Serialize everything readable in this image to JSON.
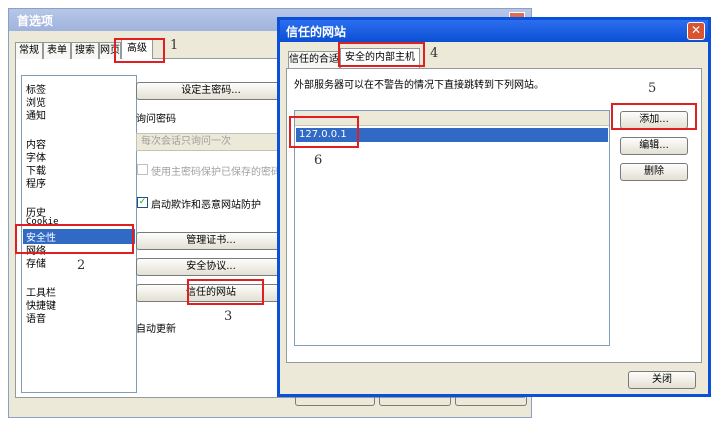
{
  "prefs": {
    "title": "首选项",
    "tabs": [
      "常规",
      "表单",
      "搜索",
      "网页",
      "高级"
    ],
    "list_items": [
      "标签",
      "浏览",
      "通知",
      "内容",
      "字体",
      "下载",
      "程序",
      "历史",
      "Cookie",
      "安全性",
      "网络",
      "存储",
      "工具栏",
      "快捷键",
      "语音"
    ],
    "selected_item": "安全性",
    "master_password_button": "设定主密码...",
    "ask_password_label": "询问密码",
    "ask_password_value": "每次会话只询问一次",
    "protect_saved_label": "使用主密码保护已保存的密码",
    "fraud_protection_label": "启动欺诈和恶意网站防护",
    "manage_certs_button": "管理证书...",
    "security_protocols_button": "安全协议...",
    "trusted_sites_button": "信任的网站",
    "auto_update_label": "自动更新"
  },
  "trust": {
    "title": "信任的网站",
    "close_glyph": "✕",
    "tabs": [
      "信任的合适",
      "安全的内部主机"
    ],
    "description": "外部服务器可以在不警告的情况下直接跳转到下列网站。",
    "hosts": [
      "127.0.0.1"
    ],
    "add_button": "添加...",
    "edit_button": "编辑...",
    "delete_button": "删除",
    "close_button": "关闭"
  },
  "annotations": [
    "1",
    "2",
    "3",
    "4",
    "5",
    "6"
  ]
}
